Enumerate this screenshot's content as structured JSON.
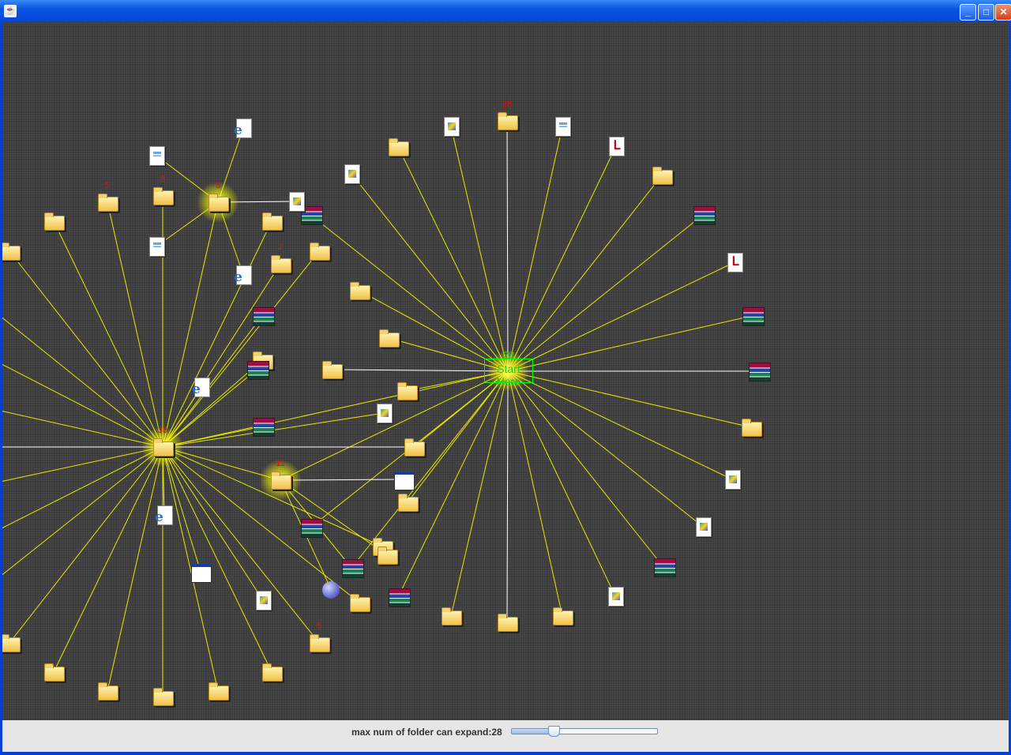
{
  "window": {
    "title": "",
    "buttons": {
      "minimize": "_",
      "maximize": "□",
      "close": "✕"
    }
  },
  "graph": {
    "start_node": {
      "label": "Start Here",
      "count": "28"
    },
    "hub_labels": {
      "left_hub": "30",
      "upper_hub": "5",
      "lower_hub": "11",
      "top_folder": "28"
    },
    "folder_labels": [
      "5",
      "5",
      "2",
      "5"
    ],
    "colors": {
      "edge": "#ffff00",
      "highlight_edge": "#ffffff",
      "background": "#3c3c3c",
      "start_box": "#00ff00",
      "label": "#e01010"
    }
  },
  "controls": {
    "slider_label": "max num of folder can expand:28",
    "slider_value": 28,
    "slider_fraction": 0.29
  }
}
